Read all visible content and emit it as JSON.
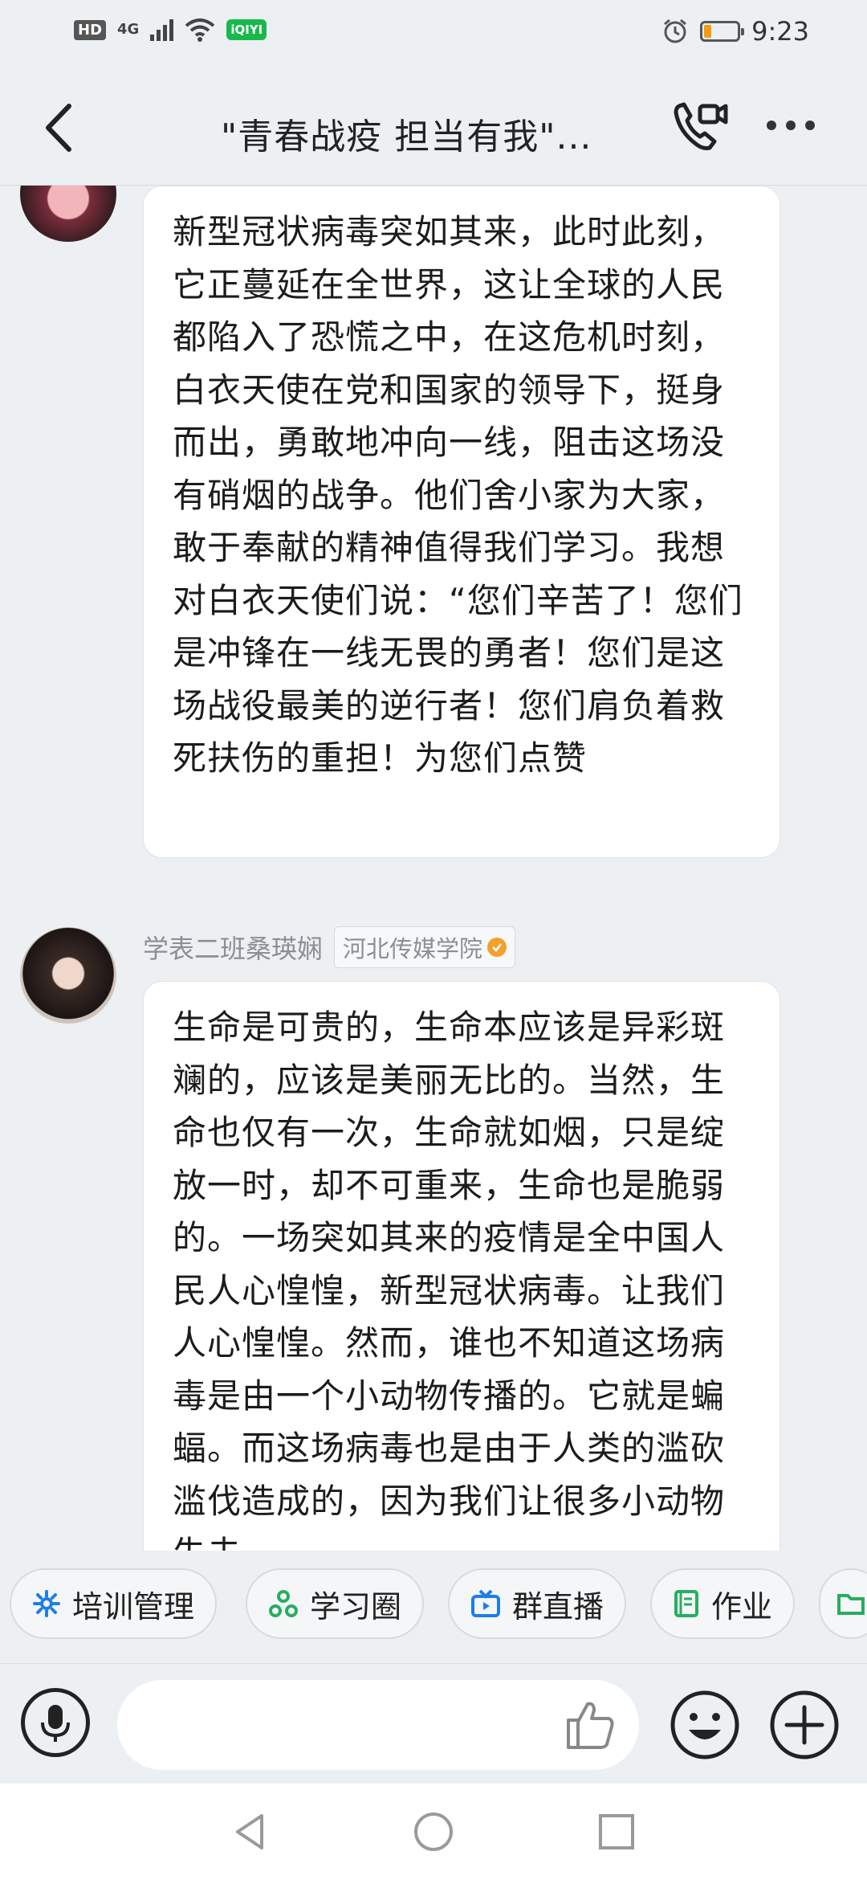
{
  "status_bar": {
    "hd_label": "HD",
    "network": "4G",
    "app_badge": "iQIYI",
    "time": "9:23",
    "battery_level": 0.2,
    "battery_color": "#f39c12"
  },
  "header": {
    "title": "\"青春战疫 担当有我\"...",
    "icons": [
      "back-icon",
      "video-call-icon",
      "more-icon"
    ]
  },
  "messages": [
    {
      "text": "新型冠状病毒突如其来，此时此刻，它正蔓延在全世界，这让全球的人民都陷入了恐慌之中，在这危机时刻，白衣天使在党和国家的领导下，挺身而出，勇敢地冲向一线，阻击这场没有硝烟的战争。他们舍小家为大家，敢于奉献的精神值得我们学习。我想对白衣天使们说：“您们辛苦了！您们是冲锋在一线无畏的勇者！您们是这场战役最美的逆行者！您们肩负着救死扶伤的重担！为您们点赞"
    },
    {
      "sender": "学表二班桑瑛娴",
      "school": "河北传媒学院",
      "text": "生命是可贵的，生命本应该是异彩斑斓的，应该是美丽无比的。当然，生命也仅有一次，生命就如烟，只是绽放一时，却不可重来，生命也是脆弱的。一场突如其来的疫情是全中国人民人心惶惶，新型冠状病毒。让我们人心惶惶。然而，谁也不知道这场病毒是由一个小动物传播的。它就是蝙蝠。而这场病毒也是由于人类的滥砍滥伐造成的，因为我们让很多小动物失去"
    }
  ],
  "quick_actions": [
    {
      "label": "培训管理",
      "icon": "gear-icon",
      "color": "#1e7ee8"
    },
    {
      "label": "学习圈",
      "icon": "circles-icon",
      "color": "#27ae60"
    },
    {
      "label": "群直播",
      "icon": "live-tv-icon",
      "color": "#1e7ee8"
    },
    {
      "label": "作业",
      "icon": "book-icon",
      "color": "#27ae60"
    }
  ],
  "input": {
    "placeholder": ""
  },
  "colors": {
    "background": "#edf0f3",
    "bubble": "#ffffff",
    "accent_blue": "#1e7ee8",
    "accent_green": "#27ae60"
  }
}
